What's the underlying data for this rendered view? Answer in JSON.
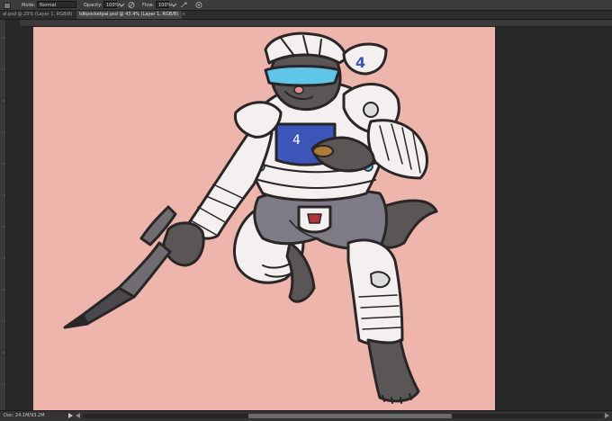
{
  "options_bar": {
    "mode_label": "Mode:",
    "mode_value": "Normal",
    "opacity_label": "Opacity:",
    "opacity_value": "100%",
    "flow_label": "Flow:",
    "flow_value": "100%",
    "icons": [
      "pressure-opacity-icon",
      "airbrush-icon",
      "pressure-size-icon"
    ]
  },
  "tabs": [
    {
      "label": "al.psd @ 25% (Layer 1, RGB/8)",
      "close": "×",
      "active": false
    },
    {
      "label": "tdkpocketpal.psd @ 43.4% (Layer 1, RGB/8)",
      "close": "×",
      "active": true
    }
  ],
  "status": {
    "doc": "Doc: 24.1M/93.2M"
  },
  "colors": {
    "canvas_bg": "#edb5ab",
    "workspace_bg": "#282828",
    "armor_white": "#f3f0ef",
    "fur_grey": "#5a5656",
    "visor_blue": "#5fc6e8",
    "chest_blue": "#3b55b8"
  }
}
